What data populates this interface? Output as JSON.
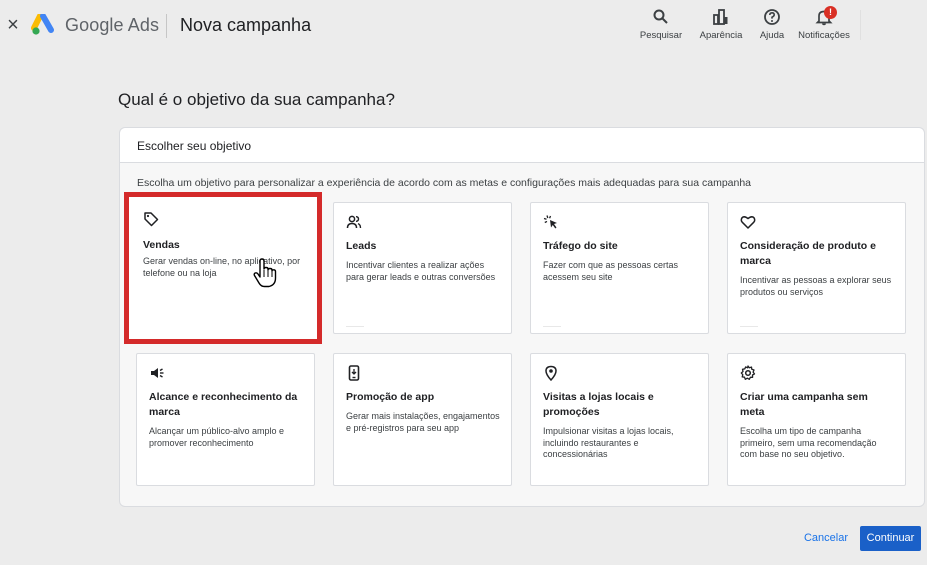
{
  "header": {
    "close_label": "×",
    "brand": "Google Ads",
    "title": "Nova campanha",
    "actions": [
      {
        "label": "Pesquisar",
        "icon": "search-icon"
      },
      {
        "label": "Aparência",
        "icon": "appearance-icon"
      },
      {
        "label": "Ajuda",
        "icon": "help-icon"
      },
      {
        "label": "Notificações",
        "icon": "bell-icon",
        "badge": "!"
      }
    ]
  },
  "question": "Qual é o objetivo da sua campanha?",
  "panel": {
    "heading": "Escolher seu objetivo",
    "description": "Escolha um objetivo para personalizar a experiência de acordo com as metas e configurações mais adequadas para sua campanha"
  },
  "objectives": [
    {
      "title": "Vendas",
      "description": "Gerar vendas on-line, no aplicativo, por telefone ou na loja",
      "icon": "tag-icon",
      "selected": true
    },
    {
      "title": "Leads",
      "description": "Incentivar clientes a realizar ações para gerar leads e outras conversões",
      "icon": "people-icon"
    },
    {
      "title": "Tráfego do site",
      "description": "Fazer com que as pessoas certas acessem seu site",
      "icon": "click-icon"
    },
    {
      "title": "Consideração de produto e marca",
      "description": "Incentivar as pessoas a explorar seus produtos ou serviços",
      "icon": "heart-icon"
    },
    {
      "title": "Alcance e reconhecimento da marca",
      "description": "Alcançar um público-alvo amplo e promover reconhecimento",
      "icon": "megaphone-icon"
    },
    {
      "title": "Promoção de app",
      "description": "Gerar mais instalações, engajamentos e pré-registros para seu app",
      "icon": "phone-icon"
    },
    {
      "title": "Visitas a lojas locais e promoções",
      "description": "Impulsionar visitas a lojas locais, incluindo restaurantes e concessionárias",
      "icon": "location-pin-icon"
    },
    {
      "title": "Criar uma campanha sem meta",
      "description": "Escolha um tipo de campanha primeiro, sem uma recomendação com base no seu objetivo.",
      "icon": "gear-icon"
    }
  ],
  "footer": {
    "cancel": "Cancelar",
    "continue": "Continuar"
  },
  "colors": {
    "accent": "#1a73e8",
    "primary_button": "#1a60c8",
    "selection_highlight": "#d42a2a"
  }
}
